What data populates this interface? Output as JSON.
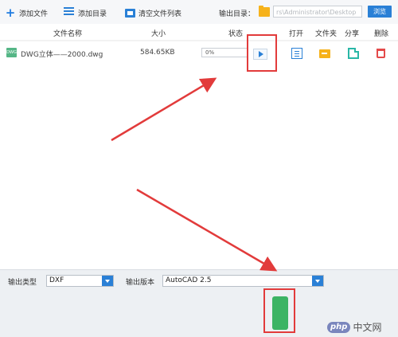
{
  "toolbar": {
    "add_file": "添加文件",
    "add_dir": "添加目录",
    "clear_list": "清空文件列表",
    "output_dir_label": "输出目录：",
    "output_path": "rs\\Administrator\\Desktop",
    "browse": "浏览"
  },
  "table": {
    "headers": {
      "name": "文件名称",
      "size": "大小",
      "status": "状态",
      "open": "打开",
      "folder": "文件夹",
      "share": "分享",
      "delete": "删除"
    },
    "rows": [
      {
        "icon_text": "DWG",
        "name": "DWG立体——2000.dwg",
        "size": "584.65KB",
        "progress_text": "0%",
        "progress": 0
      }
    ]
  },
  "bottom": {
    "output_type_label": "输出类型",
    "output_type_value": "DXF",
    "output_version_label": "输出版本",
    "output_version_value": "AutoCAD 2.5"
  },
  "watermark": {
    "logo": "php",
    "text": "中文网"
  },
  "colors": {
    "accent": "#2a80d6",
    "highlight": "#e23b3b",
    "convert": "#3cb464",
    "folder": "#f6b21b"
  },
  "icons": [
    "add-icon",
    "list-icon",
    "clear-icon",
    "folder-icon",
    "play-icon",
    "open-icon",
    "share-icon",
    "delete-icon"
  ]
}
